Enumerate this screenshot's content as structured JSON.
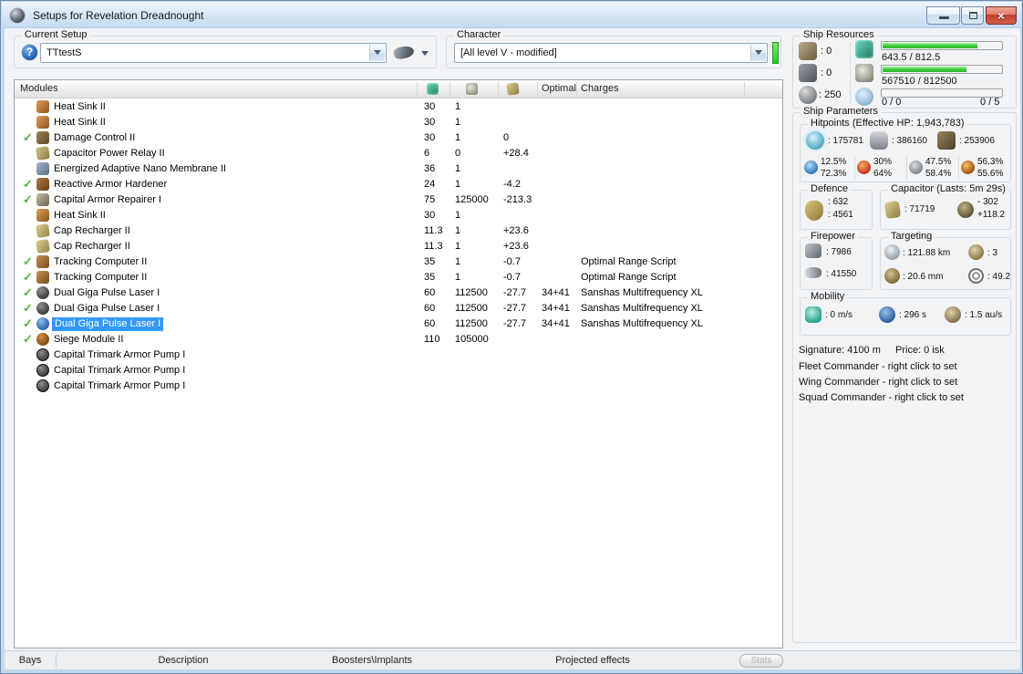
{
  "window": {
    "title": "Setups for Revelation Dreadnought"
  },
  "setup": {
    "label": "Current Setup",
    "value": "TTtestS"
  },
  "character": {
    "label": "Character",
    "value": "[All level V - modified]"
  },
  "resources": {
    "label": "Ship Resources",
    "turrets": ": 0",
    "launchers": ": 0",
    "calibration": ": 250",
    "cpu": {
      "text": "643.5 / 812.5",
      "pct": 79
    },
    "powergrid": {
      "text": "567510 / 812500",
      "pct": 70
    },
    "drones": {
      "text": "0 / 0",
      "bandwidth": "0 / 5",
      "pct": 0
    }
  },
  "modules_table": {
    "header": {
      "modules": "Modules",
      "optimal": "Optimal",
      "charges": "Charges"
    },
    "rows": [
      {
        "check": false,
        "icon": "heat-sink",
        "name": "Heat Sink II",
        "cpu": "30",
        "pg": "1",
        "cap": "",
        "optimal": "",
        "charges": ""
      },
      {
        "check": false,
        "icon": "heat-sink",
        "name": "Heat Sink II",
        "cpu": "30",
        "pg": "1",
        "cap": "",
        "optimal": "",
        "charges": ""
      },
      {
        "check": true,
        "icon": "damage-control",
        "name": "Damage Control II",
        "cpu": "30",
        "pg": "1",
        "cap": "0",
        "optimal": "",
        "charges": ""
      },
      {
        "check": false,
        "icon": "cap-relay",
        "name": "Capacitor Power Relay II",
        "cpu": "6",
        "pg": "0",
        "cap": "+28.4",
        "optimal": "",
        "charges": ""
      },
      {
        "check": false,
        "icon": "eanm",
        "name": "Energized Adaptive Nano Membrane II",
        "cpu": "36",
        "pg": "1",
        "cap": "",
        "optimal": "",
        "charges": ""
      },
      {
        "check": true,
        "icon": "armor-hardener",
        "name": "Reactive Armor Hardener",
        "cpu": "24",
        "pg": "1",
        "cap": "-4.2",
        "optimal": "",
        "charges": ""
      },
      {
        "check": true,
        "icon": "armor-repairer",
        "name": "Capital Armor Repairer I",
        "cpu": "75",
        "pg": "125000",
        "cap": "-213.3",
        "optimal": "",
        "charges": ""
      },
      {
        "check": false,
        "icon": "heat-sink",
        "name": "Heat Sink II",
        "cpu": "30",
        "pg": "1",
        "cap": "",
        "optimal": "",
        "charges": ""
      },
      {
        "check": false,
        "icon": "cap-recharger",
        "name": "Cap Recharger II",
        "cpu": "11.3",
        "pg": "1",
        "cap": "+23.6",
        "optimal": "",
        "charges": ""
      },
      {
        "check": false,
        "icon": "cap-recharger",
        "name": "Cap Recharger II",
        "cpu": "11.3",
        "pg": "1",
        "cap": "+23.6",
        "optimal": "",
        "charges": ""
      },
      {
        "check": true,
        "icon": "tracking-computer",
        "name": "Tracking Computer II",
        "cpu": "35",
        "pg": "1",
        "cap": "-0.7",
        "optimal": "",
        "charges": "Optimal Range Script"
      },
      {
        "check": true,
        "icon": "tracking-computer",
        "name": "Tracking Computer II",
        "cpu": "35",
        "pg": "1",
        "cap": "-0.7",
        "optimal": "",
        "charges": "Optimal Range Script"
      },
      {
        "check": true,
        "icon": "laser-turret",
        "name": "Dual Giga Pulse Laser I",
        "cpu": "60",
        "pg": "112500",
        "cap": "-27.7",
        "optimal": "34+41",
        "charges": "Sanshas Multifrequency XL"
      },
      {
        "check": true,
        "icon": "laser-turret",
        "name": "Dual Giga Pulse Laser I",
        "cpu": "60",
        "pg": "112500",
        "cap": "-27.7",
        "optimal": "34+41",
        "charges": "Sanshas Multifrequency XL"
      },
      {
        "check": true,
        "icon": "laser-turret",
        "name": "Dual Giga Pulse Laser I",
        "cpu": "60",
        "pg": "112500",
        "cap": "-27.7",
        "optimal": "34+41",
        "charges": "Sanshas Multifrequency XL",
        "selected": true
      },
      {
        "check": true,
        "icon": "siege-module",
        "name": "Siege Module II",
        "cpu": "110",
        "pg": "105000",
        "cap": "",
        "optimal": "",
        "charges": ""
      },
      {
        "check": false,
        "icon": "rig",
        "name": "Capital Trimark Armor Pump I",
        "cpu": "",
        "pg": "",
        "cap": "",
        "optimal": "",
        "charges": ""
      },
      {
        "check": false,
        "icon": "rig",
        "name": "Capital Trimark Armor Pump I",
        "cpu": "",
        "pg": "",
        "cap": "",
        "optimal": "",
        "charges": ""
      },
      {
        "check": false,
        "icon": "rig",
        "name": "Capital Trimark Armor Pump I",
        "cpu": "",
        "pg": "",
        "cap": "",
        "optimal": "",
        "charges": ""
      }
    ]
  },
  "params": {
    "label": "Ship Parameters",
    "hitpoints": {
      "label": "Hitpoints (Effective HP: 1,943,783)",
      "shield": ": 175781",
      "armor": ": 386160",
      "hull": ": 253906",
      "resists": [
        {
          "name": "em",
          "top": "12.5%",
          "bottom": "72.3%"
        },
        {
          "name": "thermal",
          "top": "30%",
          "bottom": "64%"
        },
        {
          "name": "kinetic",
          "top": "47.5%",
          "bottom": "58.4%"
        },
        {
          "name": "explosive",
          "top": "56.3%",
          "bottom": "55.6%"
        }
      ]
    },
    "defence": {
      "label": "Defence",
      "line1": ": 632",
      "line2": ": 4561"
    },
    "capacitor": {
      "label": "Capacitor (Lasts: 5m 29s)",
      "amount": ": 71719",
      "delta_out": "- 302",
      "delta_in": "+118.2"
    },
    "firepower": {
      "label": "Firepower",
      "turret": ": 7986",
      "volley": ": 41550"
    },
    "targeting": {
      "label": "Targeting",
      "range": ": 121.88 km",
      "max_targets": ": 3",
      "scan_res": ": 20.6 mm",
      "sensor": ": 49.2"
    },
    "mobility": {
      "label": "Mobility",
      "speed": ": 0 m/s",
      "align": ": 296 s",
      "warp": ": 1.5 au/s"
    },
    "signature": "Signature: 4100 m",
    "price": "Price: 0 isk",
    "fleet": "Fleet Commander - right click to set",
    "wing": "Wing Commander - right click to set",
    "squad": "Squad Commander - right click to set"
  },
  "bottom": {
    "tabs": [
      "Bays",
      "Description",
      "Boosters\\Implants",
      "Projected effects"
    ],
    "stats_label": "Stats"
  }
}
